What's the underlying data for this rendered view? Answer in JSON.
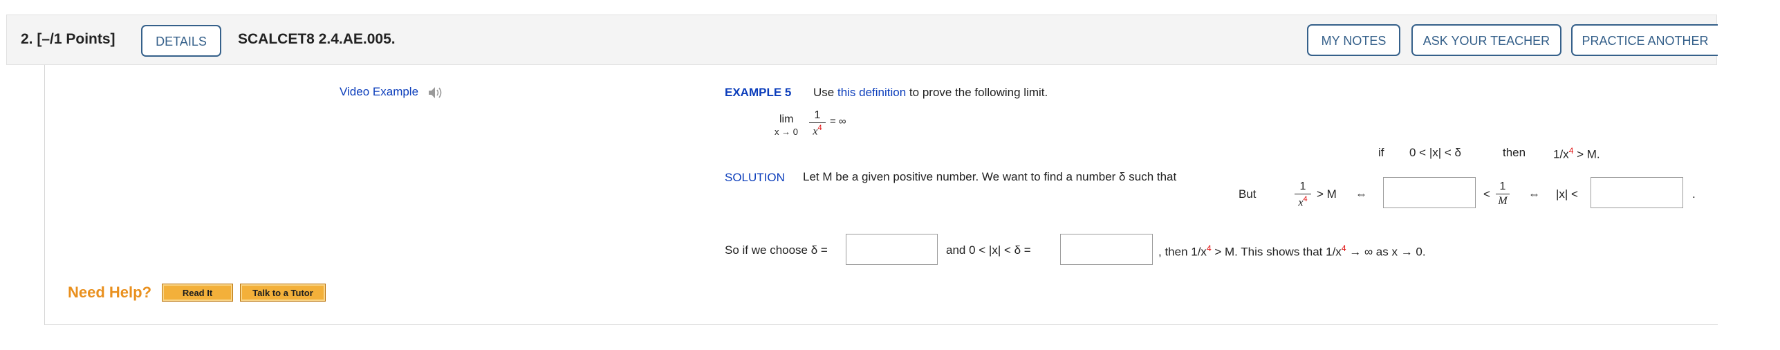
{
  "header": {
    "question_number": "2.  [–/1 Points]",
    "details_button": "DETAILS",
    "question_id": "SCALCET8 2.4.AE.005.",
    "my_notes_button": "MY NOTES",
    "ask_teacher_button": "ASK YOUR TEACHER",
    "practice_another_button": "PRACTICE ANOTHER"
  },
  "video": {
    "label": "Video Example",
    "icon": "speaker-icon"
  },
  "example": {
    "title": "EXAMPLE 5",
    "text_before": "Use ",
    "definition_link": "this definition",
    "text_after": " to prove the following limit.",
    "lim_word": "lim",
    "lim_sub": "x → 0",
    "frac_num": "1",
    "frac_den_base": "x",
    "frac_den_exp": "4",
    "equals_inf": "= ∞"
  },
  "condition": {
    "if_word": "if",
    "range": "0 < |x| < δ",
    "then_word": "then",
    "result_pre": "1/x",
    "result_exp": "4",
    "result_post": " > M."
  },
  "solution": {
    "label": "SOLUTION",
    "text": "Let M be a given positive number. We want to find a number δ such that",
    "but_word": "But",
    "ineq1_num": "1",
    "ineq1_den_base": "x",
    "ineq1_den_exp": "4",
    "ineq1_gt": "> M",
    "iff1": "⇔",
    "lt_sign": "<",
    "frac2_num": "1",
    "frac2_den": "M",
    "iff2": "⇔",
    "absx_lt": "|x| <",
    "period": ".",
    "answer1_value": "",
    "answer2_value": ""
  },
  "conclusion": {
    "so_text": "So if we choose δ =",
    "and_text": "and  0 < |x| < δ =",
    "then_text": ",  then  1/x",
    "then_exp": "4",
    "then_post": " > M.  This shows that  1/x",
    "shows_exp": "4",
    "shows_post": " → ∞  as  x → 0.",
    "answer3_value": "",
    "answer4_value": ""
  },
  "help": {
    "label": "Need Help?",
    "read_it": "Read It",
    "talk_to_tutor": "Talk to a Tutor"
  },
  "colors": {
    "accent": "#35608a",
    "link": "#0b3dbb",
    "exponent": "#e01010",
    "help_orange": "#e9901e",
    "help_button": "#f3b03a"
  }
}
